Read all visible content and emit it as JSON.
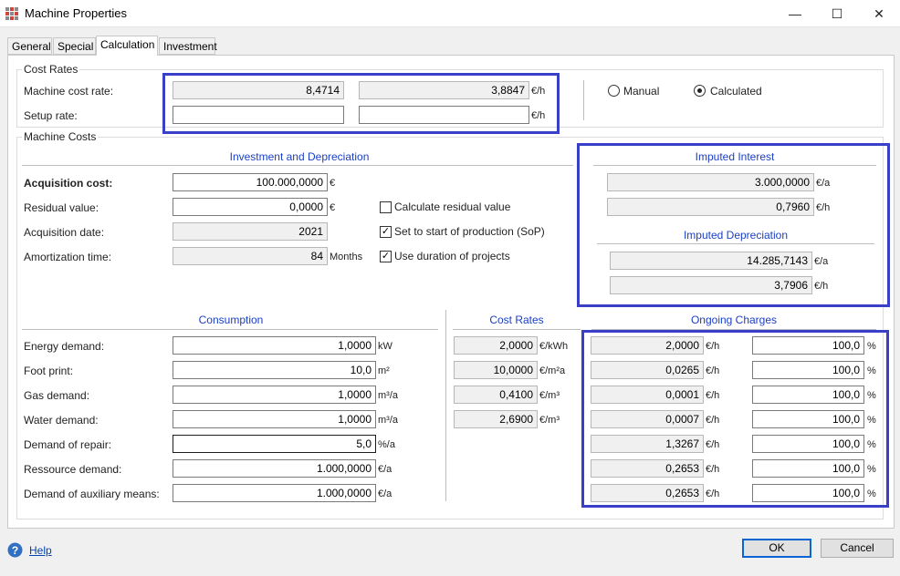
{
  "window": {
    "title": "Machine Properties",
    "minimize": "—",
    "maximize": "☐",
    "close": "✕"
  },
  "tabs": [
    "General",
    "Special",
    "Calculation",
    "Investment"
  ],
  "cost_rates": {
    "group_title": "Cost Rates",
    "machine_cost_rate_label": "Machine cost rate:",
    "machine_cost_rate_value1": "8,4714",
    "machine_cost_rate_value2": "3,8847",
    "machine_cost_rate_unit": "€/h",
    "setup_rate_label": "Setup rate:",
    "setup_rate_value1": "",
    "setup_rate_value2": "",
    "setup_rate_unit": "€/h",
    "manual_label": "Manual",
    "calculated_label": "Calculated"
  },
  "machine_costs": {
    "group_title": "Machine Costs",
    "investment_header": "Investment and Depreciation",
    "acquisition_cost_label": "Acquisition cost:",
    "acquisition_cost_value": "100.000,0000",
    "acquisition_cost_unit": "€",
    "residual_value_label": "Residual value:",
    "residual_value_value": "0,0000",
    "residual_value_unit": "€",
    "acquisition_date_label": "Acquisition date:",
    "acquisition_date_value": "2021",
    "amortization_time_label": "Amortization time:",
    "amortization_time_value": "84",
    "amortization_time_unit": "Months",
    "calc_residual_label": "Calculate residual value",
    "set_start_label": "Set to start of production (SoP)",
    "use_duration_label": "Use duration of projects",
    "imputed_interest_header": "Imputed Interest",
    "interest_value1": "3.000,0000",
    "interest_unit1": "€/a",
    "interest_value2": "0,7960",
    "interest_unit2": "€/h",
    "imputed_depreciation_header": "Imputed Depreciation",
    "depreciation_value1": "14.285,7143",
    "depreciation_unit1": "€/a",
    "depreciation_value2": "3,7906",
    "depreciation_unit2": "€/h"
  },
  "consumption": {
    "header": "Consumption",
    "cost_rates_header": "Cost Rates",
    "ongoing_header": "Ongoing Charges",
    "rows": [
      {
        "label": "Energy demand:",
        "value": "1,0000",
        "unit": "kW",
        "rate": "2,0000",
        "rate_unit": "€/kWh",
        "charge": "2,0000",
        "charge_unit": "€/h",
        "pct": "100,0",
        "pct_unit": "%"
      },
      {
        "label": "Foot print:",
        "value": "10,0",
        "unit": "m²",
        "rate": "10,0000",
        "rate_unit": "€/m²a",
        "charge": "0,0265",
        "charge_unit": "€/h",
        "pct": "100,0",
        "pct_unit": "%"
      },
      {
        "label": "Gas demand:",
        "value": "1,0000",
        "unit": "m³/a",
        "rate": "0,4100",
        "rate_unit": "€/m³",
        "charge": "0,0001",
        "charge_unit": "€/h",
        "pct": "100,0",
        "pct_unit": "%"
      },
      {
        "label": "Water demand:",
        "value": "1,0000",
        "unit": "m³/a",
        "rate": "2,6900",
        "rate_unit": "€/m³",
        "charge": "0,0007",
        "charge_unit": "€/h",
        "pct": "100,0",
        "pct_unit": "%"
      },
      {
        "label": "Demand of repair:",
        "value": "5,0",
        "unit": "%/a",
        "rate": null,
        "rate_unit": null,
        "charge": "1,3267",
        "charge_unit": "€/h",
        "pct": "100,0",
        "pct_unit": "%"
      },
      {
        "label": "Ressource demand:",
        "value": "1.000,0000",
        "unit": "€/a",
        "rate": null,
        "rate_unit": null,
        "charge": "0,2653",
        "charge_unit": "€/h",
        "pct": "100,0",
        "pct_unit": "%"
      },
      {
        "label": "Demand of auxiliary means:",
        "value": "1.000,0000",
        "unit": "€/a",
        "rate": null,
        "rate_unit": null,
        "charge": "0,2653",
        "charge_unit": "€/h",
        "pct": "100,0",
        "pct_unit": "%"
      }
    ]
  },
  "footer": {
    "help_label": "Help",
    "ok_label": "OK",
    "cancel_label": "Cancel"
  },
  "colors": {
    "highlight": "#3a3fc8",
    "section_header": "#1a3fc4",
    "help_icon": "#2f6fc4"
  },
  "icons": {
    "app": "machine-app-icon",
    "help": "help-question-icon",
    "check": "✓"
  }
}
